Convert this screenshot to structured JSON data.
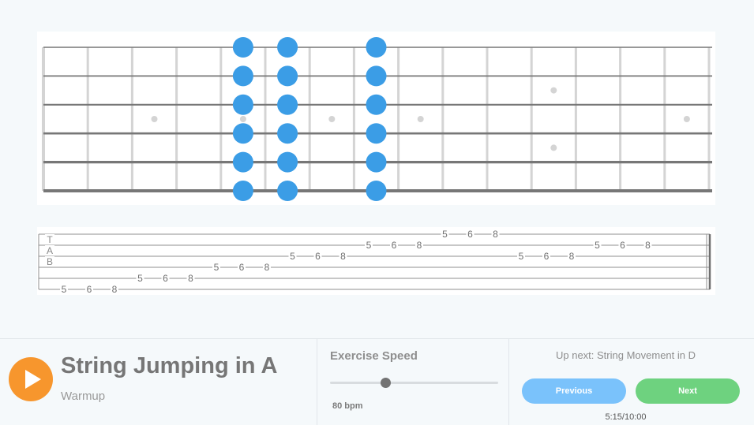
{
  "colors": {
    "note": "#3b9de6",
    "string": "#777777",
    "fret": "#d4d4d4",
    "inlay": "#d4d4d4",
    "play": "#f7962d",
    "previous": "#7ac2fb",
    "next": "#6ed27f"
  },
  "fretboard": {
    "frets": 16,
    "strings": 6,
    "inlay_frets_single": [
      3,
      5,
      7,
      9,
      15
    ],
    "inlay_fret_double": 12,
    "note_frets": [
      5,
      6,
      8
    ]
  },
  "tab": {
    "clef": [
      "T",
      "A",
      "B"
    ],
    "groups": [
      {
        "string": 6,
        "frets": [
          "5",
          "6",
          "8"
        ]
      },
      {
        "string": 5,
        "frets": [
          "5",
          "6",
          "8"
        ]
      },
      {
        "string": 4,
        "frets": [
          "5",
          "6",
          "8"
        ]
      },
      {
        "string": 3,
        "frets": [
          "5",
          "6",
          "8"
        ]
      },
      {
        "string": 2,
        "frets": [
          "5",
          "6",
          "8"
        ]
      },
      {
        "string": 1,
        "frets": [
          "5",
          "6",
          "8"
        ]
      },
      {
        "string": 3,
        "frets": [
          "5",
          "6",
          "8"
        ]
      },
      {
        "string": 2,
        "frets": [
          "5",
          "6",
          "8"
        ]
      }
    ]
  },
  "player": {
    "play_icon": "play-icon",
    "title": "String Jumping in A",
    "subtitle": "Warmup"
  },
  "speed": {
    "label": "Exercise Speed",
    "bpm_value": 80,
    "bpm_text": "80 bpm",
    "slider_level": 0.33
  },
  "navigation": {
    "up_next": "Up next: String Movement in D",
    "previous_label": "Previous",
    "next_label": "Next",
    "timer": "5:15/10:00"
  }
}
